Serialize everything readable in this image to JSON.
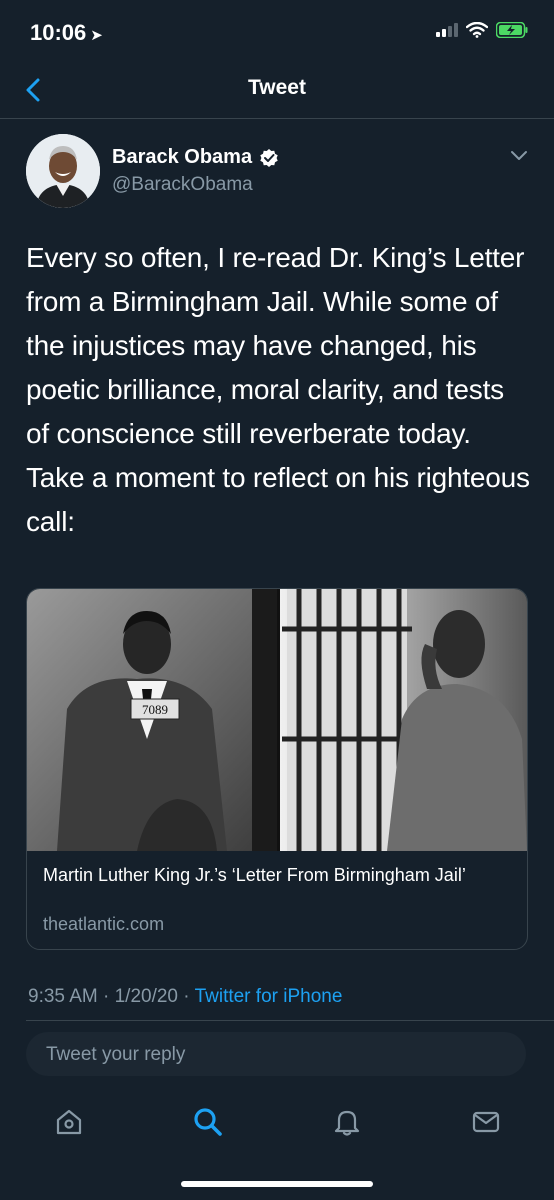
{
  "status_bar": {
    "time": "10:06",
    "location_arrow": "location-arrow-icon"
  },
  "nav": {
    "title": "Tweet"
  },
  "author": {
    "name": "Barack Obama",
    "handle": "@BarackObama"
  },
  "tweet": {
    "text": "Every so often, I re-read Dr. King’s Letter from a Birmingham Jail. While some of the injustices may have changed, his poetic brilliance, moral clarity, and tests of conscience still reverberate today. Take a moment to reflect on his righteous call:"
  },
  "card": {
    "image_label": "7089",
    "title": "Martin Luther King Jr.’s ‘Letter From Birmingham Jail’",
    "domain": "theatlantic.com"
  },
  "meta": {
    "time": "9:35 AM",
    "date": "1/20/20",
    "separator": "·",
    "source": "Twitter for iPhone"
  },
  "reply": {
    "placeholder": "Tweet your reply"
  },
  "tabs": [
    "home-icon",
    "search-icon",
    "notifications-icon",
    "messages-icon"
  ],
  "colors": {
    "background": "#15202b",
    "accent": "#1da1f2",
    "secondary_text": "#8899a6",
    "border": "#38444d",
    "battery": "#4cd964"
  }
}
